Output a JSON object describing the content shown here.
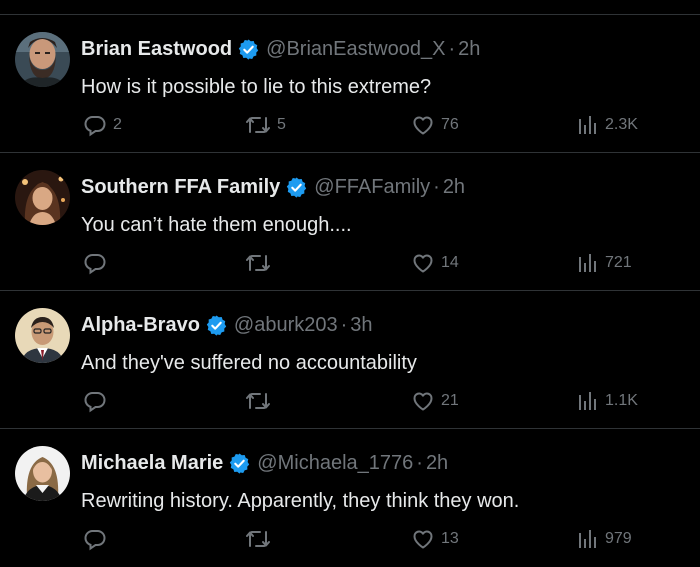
{
  "colors": {
    "background": "#000000",
    "text": "#e7e9ea",
    "secondary": "#71767b",
    "divider": "#2f3336",
    "verified": "#1d9bf0"
  },
  "tweets": [
    {
      "name": "Brian Eastwood",
      "handle": "@BrianEastwood_X",
      "time": "2h",
      "text": "How is it possible to lie to this extreme?",
      "replies": "2",
      "retweets": "5",
      "likes": "76",
      "views": "2.3K",
      "avatar": "bearded-man-avatar"
    },
    {
      "name": "Southern FFA Family",
      "handle": "@FFAFamily",
      "time": "2h",
      "text": "You can’t hate them enough....",
      "replies": "",
      "retweets": "",
      "likes": "14",
      "views": "721",
      "avatar": "woman-long-hair-avatar"
    },
    {
      "name": "Alpha-Bravo",
      "handle": "@aburk203",
      "time": "3h",
      "text": "And they've suffered no accountability",
      "replies": "",
      "retweets": "",
      "likes": "21",
      "views": "1.1K",
      "avatar": "man-in-suit-avatar"
    },
    {
      "name": "Michaela Marie",
      "handle": "@Michaela_1776",
      "time": "2h",
      "text": "Rewriting history. Apparently, they think they won.",
      "replies": "",
      "retweets": "",
      "likes": "13",
      "views": "979",
      "avatar": "woman-blonde-avatar"
    }
  ],
  "icons": {
    "verified": "verified-badge-icon",
    "reply": "reply-icon",
    "retweet": "retweet-icon",
    "like": "heart-icon",
    "views": "views-bar-chart-icon"
  },
  "separator": "·"
}
